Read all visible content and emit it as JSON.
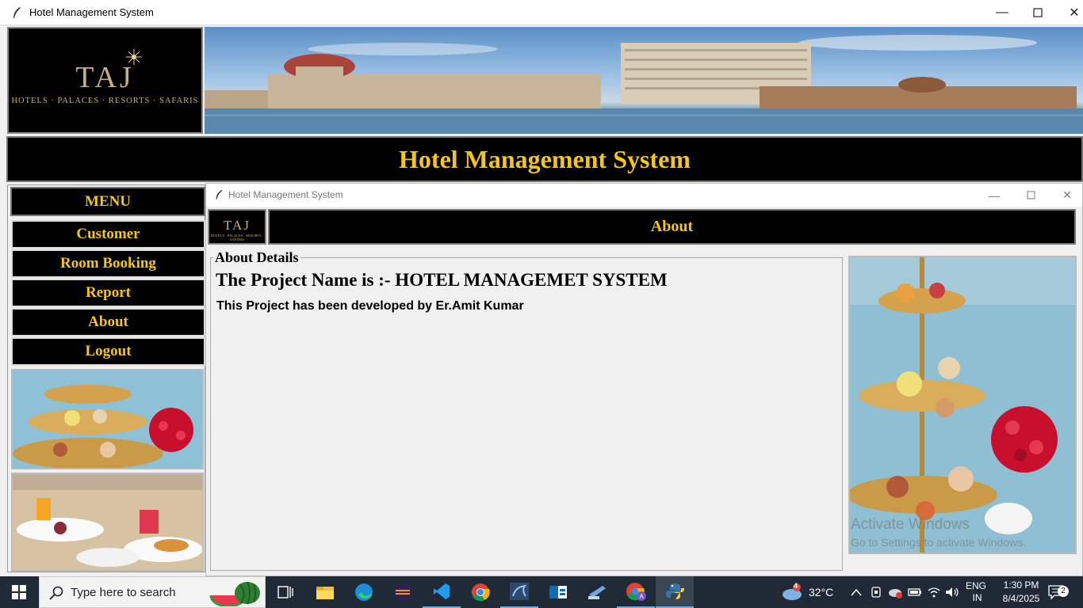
{
  "window": {
    "title": "Hotel Management System"
  },
  "logo": {
    "brand": "TAJ",
    "tagline": "HOTELS · PALACES · RESORTS · SAFARIS"
  },
  "header": {
    "title": "Hotel Management System"
  },
  "menu": {
    "heading": "MENU",
    "items": [
      {
        "label": "Customer"
      },
      {
        "label": "Room Booking"
      },
      {
        "label": "Report"
      },
      {
        "label": "About"
      },
      {
        "label": "Logout"
      }
    ]
  },
  "child_window": {
    "title": "Hotel Management System",
    "header": "About",
    "group_label": "About Details",
    "project_line": "The Project Name is :- HOTEL MANAGEMET SYSTEM",
    "developer_line": "This Project has been developed by Er.Amit Kumar"
  },
  "watermark": {
    "line1": "Activate Windows",
    "line2": "Go to Settings to activate Windows."
  },
  "taskbar": {
    "search_placeholder": "Type here to search",
    "weather_temp": "32°C",
    "weather_badge": "4",
    "lang_line1": "ENG",
    "lang_line2": "IN",
    "time": "1:30 PM",
    "date": "8/4/2025",
    "notification_count": "2"
  },
  "colors": {
    "accent_text": "#f5c518",
    "header_bg": "#000000",
    "taskbar_bg": "#1f2a36"
  },
  "icons": [
    "feather-icon",
    "minimize-icon",
    "maximize-icon",
    "close-icon",
    "windows-start-icon",
    "search-icon",
    "task-view-icon",
    "file-explorer-icon",
    "edge-icon",
    "eclipse-icon",
    "vscode-icon",
    "chrome-icon",
    "mysql-icon",
    "outlook-icon",
    "desktop-icon",
    "chrome-profile-icon",
    "python-icon",
    "weather-icon",
    "chevron-up-icon",
    "network-icon",
    "volume-icon",
    "battery-icon",
    "notification-icon"
  ]
}
